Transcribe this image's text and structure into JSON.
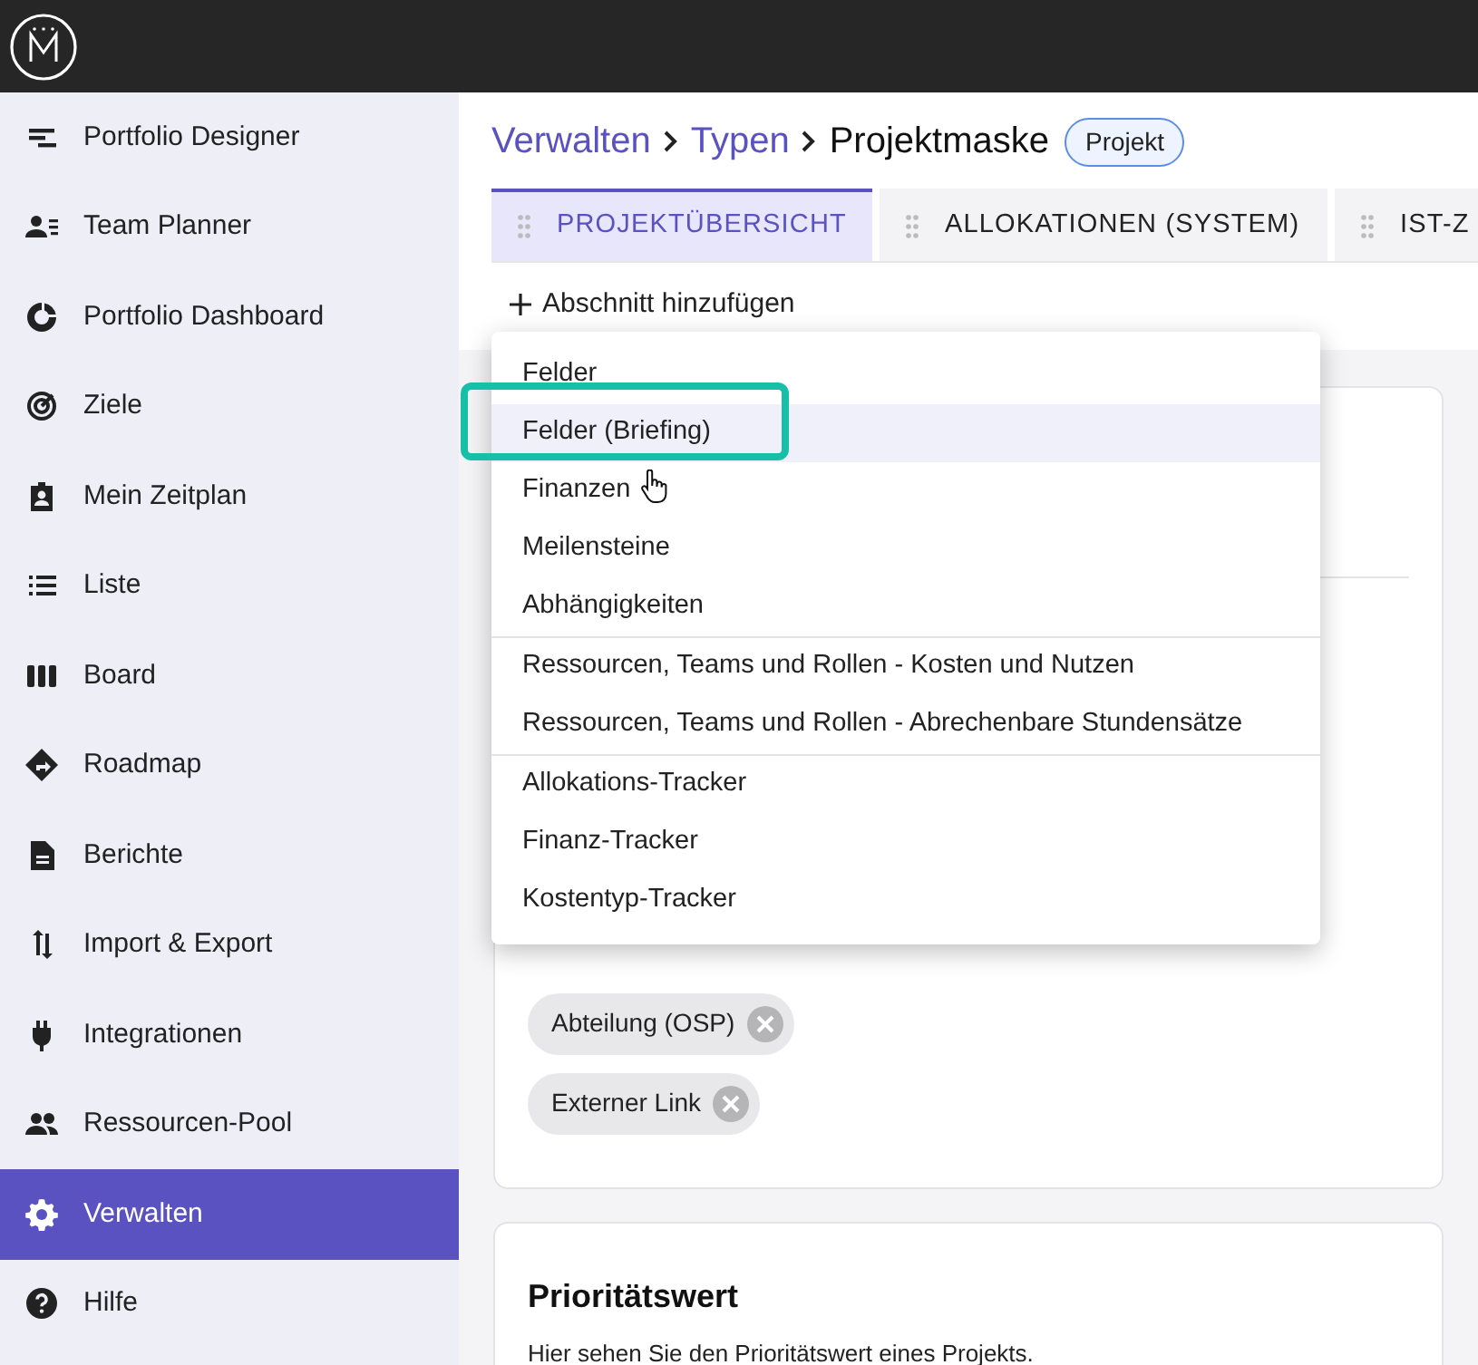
{
  "sidebar": {
    "items": [
      {
        "label": "Portfolio Designer",
        "selected": false
      },
      {
        "label": "Team Planner",
        "selected": false
      },
      {
        "label": "Portfolio Dashboard",
        "selected": false
      },
      {
        "label": "Ziele",
        "selected": false
      },
      {
        "label": "Mein Zeitplan",
        "selected": false
      },
      {
        "label": "Liste",
        "selected": false
      },
      {
        "label": "Board",
        "selected": false
      },
      {
        "label": "Roadmap",
        "selected": false
      },
      {
        "label": "Berichte",
        "selected": false
      },
      {
        "label": "Import & Export",
        "selected": false
      },
      {
        "label": "Integrationen",
        "selected": false
      },
      {
        "label": "Ressourcen-Pool",
        "selected": false
      },
      {
        "label": "Verwalten",
        "selected": true
      },
      {
        "label": "Hilfe",
        "selected": false
      }
    ]
  },
  "breadcrumb": [
    "Verwalten",
    "Typen",
    "Projektmaske"
  ],
  "type_badge": "Projekt",
  "tabs": [
    {
      "label": "PROJEKTÜBERSICHT",
      "selected": true
    },
    {
      "label": "ALLOKATIONEN (SYSTEM)",
      "selected": false
    },
    {
      "label": "IST-Z",
      "selected": false
    }
  ],
  "add_section": "Abschnitt hinzufügen",
  "menu": {
    "groups": [
      [
        {
          "label": "Felder",
          "hovered": false
        },
        {
          "label": "Felder (Briefing)",
          "hovered": true
        },
        {
          "label": "Finanzen",
          "hovered": false
        },
        {
          "label": "Meilensteine",
          "hovered": false
        },
        {
          "label": "Abhängigkeiten",
          "hovered": false
        }
      ],
      [
        {
          "label": "Ressourcen, Teams und Rollen - Kosten und Nutzen",
          "hovered": false
        },
        {
          "label": "Ressourcen, Teams und Rollen - Abrechenbare Stundensätze",
          "hovered": false
        }
      ],
      [
        {
          "label": "Allokations-Tracker",
          "hovered": false
        },
        {
          "label": "Finanz-Tracker",
          "hovered": false
        },
        {
          "label": "Kostentyp-Tracker",
          "hovered": false
        }
      ]
    ]
  },
  "field_chips": [
    "Abteilung (OSP)",
    "Externer Link"
  ],
  "priority_card": {
    "title": "Prioritätswert",
    "description": "Hier sehen Sie den Prioritätswert eines Projekts."
  }
}
